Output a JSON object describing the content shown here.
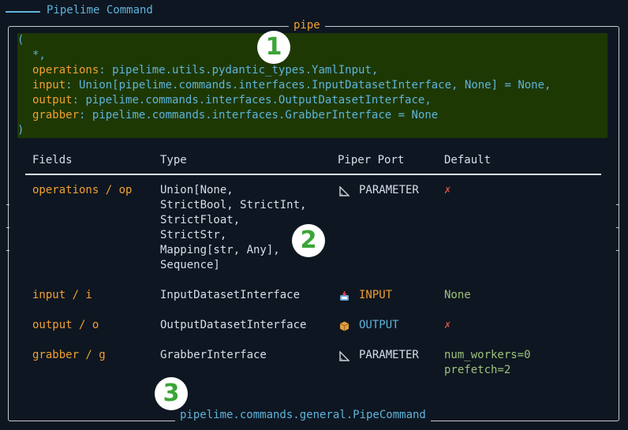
{
  "header": {
    "title": "Pipelime Command"
  },
  "panel": {
    "title": "pipe",
    "footer": "pipelime.commands.general.PipeCommand"
  },
  "signature": {
    "open": "(",
    "star": "*,",
    "params": [
      {
        "name": "operations",
        "type": "pipelime.utils.pydantic_types.YamlInput,"
      },
      {
        "name": "input",
        "type": "Union[pipelime.commands.interfaces.InputDatasetInterface, None] = None,"
      },
      {
        "name": "output",
        "type": "pipelime.commands.interfaces.OutputDatasetInterface,"
      },
      {
        "name": "grabber",
        "type": "pipelime.commands.interfaces.GrabberInterface = None"
      }
    ],
    "colon": ":",
    "close": ")"
  },
  "table": {
    "headers": [
      "Fields",
      "Type",
      "Piper Port",
      "Default"
    ],
    "rows": [
      {
        "field": "operations / op",
        "type_lines": [
          "Union[None,",
          "StrictBool, StrictInt,",
          "StrictFloat,",
          "StrictStr,",
          "Mapping[str, Any],",
          "Sequence]"
        ],
        "port": "PARAMETER",
        "port_icon": "ruler-triangle-icon",
        "default": "✗"
      },
      {
        "field": "input / i",
        "type_lines": [
          "InputDatasetInterface"
        ],
        "port": "INPUT",
        "port_icon": "inbox-icon",
        "default": "None"
      },
      {
        "field": "output / o",
        "type_lines": [
          "OutputDatasetInterface"
        ],
        "port": "OUTPUT",
        "port_icon": "package-icon",
        "default": "✗"
      },
      {
        "field": "grabber / g",
        "type_lines": [
          "GrabberInterface"
        ],
        "port": "PARAMETER",
        "port_icon": "ruler-triangle-icon",
        "default_lines": [
          "num_workers=0",
          "prefetch=2"
        ]
      }
    ]
  },
  "annotations": {
    "badges": [
      "1",
      "2",
      "3"
    ]
  },
  "colors": {
    "background": "#0e1621",
    "orange": "#f0a030",
    "blue": "#5fb3d9",
    "green_block": "#1e3804",
    "green_text": "#9cc27a",
    "red": "#d9534f",
    "badge_green": "#3aa537"
  }
}
